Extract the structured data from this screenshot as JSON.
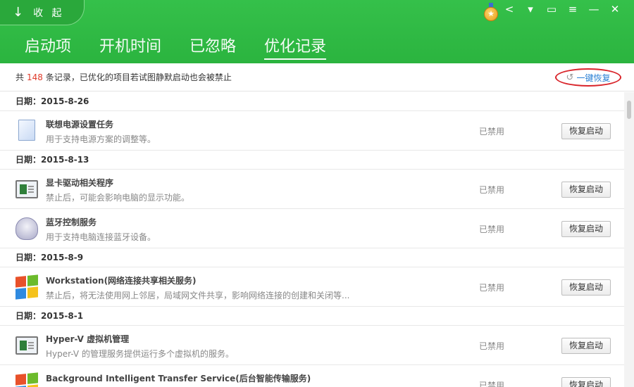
{
  "header": {
    "collapse_label": "收 起",
    "tabs": [
      {
        "label": "启动项",
        "active": false
      },
      {
        "label": "开机时间",
        "active": false
      },
      {
        "label": "已忽略",
        "active": false
      },
      {
        "label": "优化记录",
        "active": true
      }
    ],
    "accent_color": "#2bb43f"
  },
  "summary": {
    "prefix": "共",
    "count": "148",
    "suffix": "条记录，已优化的项目若试图静默启动也会被禁止",
    "restore_all_label": "一键恢复"
  },
  "groups": [
    {
      "date": "日期：2015-8-26",
      "items": [
        {
          "icon": "document-icon",
          "title": "联想电源设置任务",
          "desc": "用于支持电源方案的调整等。",
          "status": "已禁用",
          "action": "恢复启动"
        }
      ]
    },
    {
      "date": "日期：2015-8-13",
      "items": [
        {
          "icon": "monitor-icon",
          "title": "显卡驱动相关程序",
          "desc": "禁止后，可能会影响电脑的显示功能。",
          "status": "已禁用",
          "action": "恢复启动"
        },
        {
          "icon": "bluetooth-device-icon",
          "title": "蓝牙控制服务",
          "desc": "用于支持电脑连接蓝牙设备。",
          "status": "已禁用",
          "action": "恢复启动"
        }
      ]
    },
    {
      "date": "日期：2015-8-9",
      "items": [
        {
          "icon": "windows-service-icon",
          "title": "Workstation(网络连接共享相关服务)",
          "desc": "禁止后，将无法使用网上邻居，局域网文件共享，影响网络连接的创建和关闭等...",
          "status": "已禁用",
          "action": "恢复启动"
        }
      ]
    },
    {
      "date": "日期：2015-8-1",
      "items": [
        {
          "icon": "monitor-icon",
          "title": "Hyper-V 虚拟机管理",
          "desc": "Hyper-V 的管理服务提供运行多个虚拟机的服务。",
          "status": "已禁用",
          "action": "恢复启动"
        },
        {
          "icon": "windows-service-icon",
          "title": "Background Intelligent Transfer Service(后台智能传输服务)",
          "desc": "",
          "status": "已禁用",
          "action": "恢复启动"
        }
      ]
    }
  ]
}
